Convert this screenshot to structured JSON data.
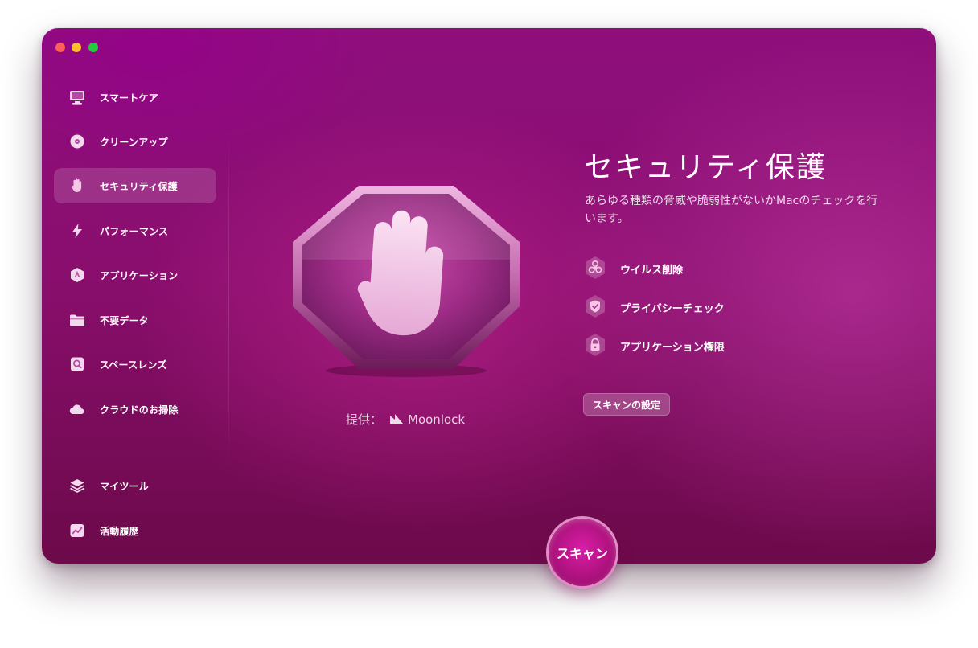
{
  "colors": {
    "accent": "#b0127f",
    "window_top": "#8e0f7c",
    "window_bottom": "#6c0a4a"
  },
  "sidebar": {
    "items": [
      {
        "label": "スマートケア",
        "icon": "monitor-icon",
        "active": false
      },
      {
        "label": "クリーンアップ",
        "icon": "disk-icon",
        "active": false
      },
      {
        "label": "セキュリティ保護",
        "icon": "hand-icon",
        "active": true
      },
      {
        "label": "パフォーマンス",
        "icon": "lightning-icon",
        "active": false
      },
      {
        "label": "アプリケーション",
        "icon": "app-icon",
        "active": false
      },
      {
        "label": "不要データ",
        "icon": "folder-icon",
        "active": false
      },
      {
        "label": "スペースレンズ",
        "icon": "lens-icon",
        "active": false
      },
      {
        "label": "クラウドのお掃除",
        "icon": "cloud-icon",
        "active": false
      },
      {
        "label": "マイツール",
        "icon": "layers-icon",
        "active": false
      },
      {
        "label": "活動履歴",
        "icon": "activity-icon",
        "active": false
      }
    ]
  },
  "main": {
    "title": "セキュリティ保護",
    "description": "あらゆる種類の脅威や脆弱性がないかMacのチェックを行います。",
    "provider_prefix": "提供：",
    "provider_name": "Moonlock",
    "features": [
      {
        "label": "ウイルス削除",
        "icon": "biohazard-icon"
      },
      {
        "label": "プライバシーチェック",
        "icon": "shield-icon"
      },
      {
        "label": "アプリケーション権限",
        "icon": "lock-icon"
      }
    ],
    "settings_button": "スキャンの設定",
    "scan_button": "スキャン"
  }
}
